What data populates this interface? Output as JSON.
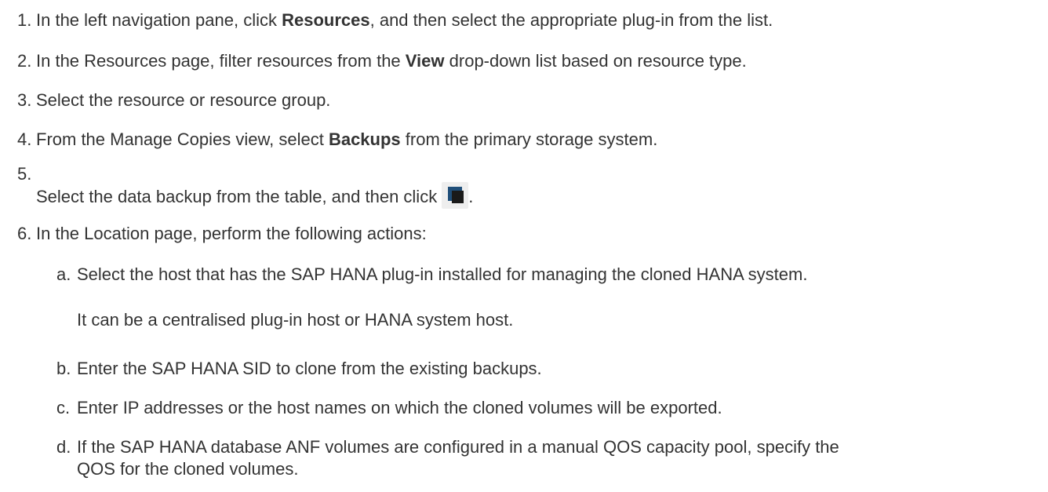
{
  "steps": [
    {
      "num": "1.",
      "pre": "In the left navigation pane, click ",
      "bold": "Resources",
      "post": ", and then select the appropriate plug-in from the list."
    },
    {
      "num": "2.",
      "pre": "In the Resources page, filter resources from the ",
      "bold": "View",
      "post": " drop-down list based on resource type."
    },
    {
      "num": "3.",
      "text": "Select the resource or resource group."
    },
    {
      "num": "4.",
      "pre": "From the Manage Copies view, select ",
      "bold": "Backups",
      "post": " from the primary storage system."
    },
    {
      "num": "5.",
      "text": "Select the data backup from the table, and then click",
      "post": "."
    },
    {
      "num": "6.",
      "text": "In the Location page, perform the following actions:"
    }
  ],
  "substeps": [
    {
      "letter": "a.",
      "text": "Select the host that has the SAP HANA plug-in installed for managing the cloned HANA system.",
      "note": "It can be a centralised plug-in host or HANA system host."
    },
    {
      "letter": "b.",
      "text": "Enter the SAP HANA SID to clone from the existing backups."
    },
    {
      "letter": "c.",
      "text": "Enter IP addresses or the host names on which the cloned volumes will be exported."
    },
    {
      "letter": "d.",
      "text": "If the SAP HANA database ANF volumes are configured in a manual QOS capacity pool, specify the",
      "text2": "QOS for the cloned volumes."
    }
  ],
  "icons": {
    "clone_button": "clone-icon"
  }
}
